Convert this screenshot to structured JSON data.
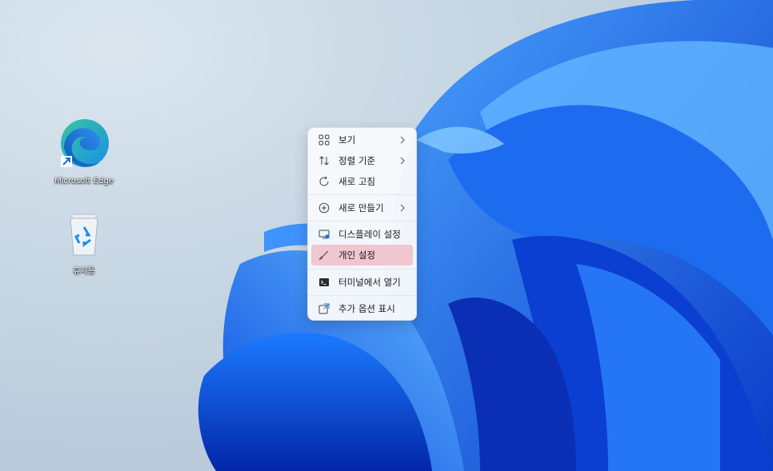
{
  "desktop": {
    "icons": [
      {
        "label": "Microsoft Edge",
        "icon": "edge-icon"
      },
      {
        "label": "휴지통",
        "icon": "recycle-bin-icon"
      }
    ]
  },
  "context_menu": {
    "items": [
      {
        "label": "보기",
        "icon": "view-grid-icon",
        "submenu": true
      },
      {
        "label": "정렬 기준",
        "icon": "sort-icon",
        "submenu": true
      },
      {
        "label": "새로 고침",
        "icon": "refresh-icon",
        "submenu": false
      },
      {
        "label": "새로 만들기",
        "icon": "new-plus-icon",
        "submenu": true
      },
      {
        "label": "디스플레이 설정",
        "icon": "display-icon",
        "submenu": false
      },
      {
        "label": "개인 설정",
        "icon": "brush-icon",
        "submenu": false,
        "highlighted": true
      },
      {
        "label": "터미널에서 열기",
        "icon": "terminal-icon",
        "submenu": false
      },
      {
        "label": "추가 옵션 표시",
        "icon": "more-options-icon",
        "submenu": false
      }
    ],
    "highlight_color": "#f0c6cf",
    "accent_color": "#1f6fd6"
  }
}
